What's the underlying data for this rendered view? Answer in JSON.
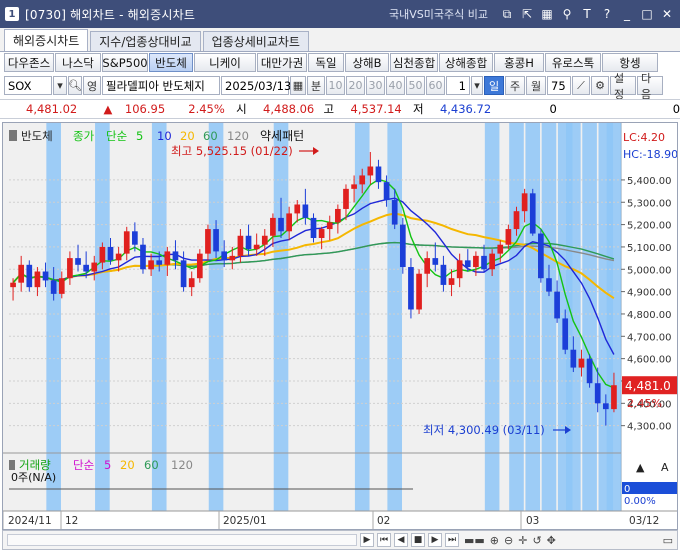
{
  "window": {
    "number": "1",
    "title": "[0730] 해외차트 - 해외증시차트",
    "compare_label": "국내VS미국주식 비교",
    "icons": [
      "link-icon",
      "popout-icon",
      "grid-icon",
      "pin-icon",
      "font-icon",
      "help-icon",
      "minimize-icon",
      "maximize-icon",
      "close-icon"
    ],
    "icon_glyphs": [
      "⧉",
      "⇱",
      "▦",
      "⚲",
      "T",
      "?",
      "_",
      "□",
      "✕"
    ]
  },
  "tabs": [
    {
      "label": "해외증시차트",
      "active": true
    },
    {
      "label": "지수/업종상대비교",
      "active": false
    },
    {
      "label": "업종상세비교차트",
      "active": false
    }
  ],
  "markets": [
    {
      "label": "다우존스",
      "w": 50
    },
    {
      "label": "나스닥",
      "w": 46
    },
    {
      "label": "S&P500",
      "w": 46
    },
    {
      "label": "반도체",
      "w": 44,
      "active": true
    },
    {
      "label": "니케이",
      "w": 62
    },
    {
      "label": "대만가권",
      "w": 50
    },
    {
      "label": "독일",
      "w": 36
    },
    {
      "label": "상해B",
      "w": 44
    },
    {
      "label": "심천종합",
      "w": 48
    },
    {
      "label": "상해종합",
      "w": 54
    },
    {
      "label": "홍콩H",
      "w": 50
    },
    {
      "label": "유로스톡",
      "w": 56
    },
    {
      "label": "항셍",
      "w": 56
    }
  ],
  "controls": {
    "symbol": "SOX",
    "type_label": "영",
    "name": "필라델피아 반도체지",
    "date": "2025/03/13",
    "period_min": "분",
    "periods": [
      "10",
      "20",
      "30",
      "40",
      "50",
      "60"
    ],
    "interval_value": "1",
    "day": "일",
    "week": "주",
    "month": "월",
    "count": "75",
    "settings": "설정",
    "next": "다음"
  },
  "quote": {
    "price": "4,481.02",
    "change_arrow": "▲",
    "change": "106.95",
    "change_pct": "2.45%",
    "open_label": "시",
    "open": "4,488.06",
    "high_label": "고",
    "high": "4,537.14",
    "low_label": "저",
    "low": "4,436.72",
    "volume": "0",
    "volume2": "0"
  },
  "chart_data": {
    "type": "candlestick",
    "legend": {
      "name": "반도체",
      "price_label": "종가",
      "ma_label": "단순",
      "ma_periods": [
        "5",
        "10",
        "20",
        "60",
        "120"
      ],
      "pattern": "약세패턴"
    },
    "ma_colors": {
      "5": "#13c313",
      "10": "#1f27d8",
      "20": "#f5b700",
      "60": "#2f9a58",
      "120": "#888888"
    },
    "annotations": {
      "high": "최고 5,525.15 (01/22)",
      "low": "최저 4,300.49 (03/11)"
    },
    "axis_right": {
      "lc": "LC:4.20",
      "hc": "HC:-18.90",
      "ticks": [
        "5,400.00",
        "5,300.00",
        "5,200.00",
        "5,100.00",
        "5,000.00",
        "4,900.00",
        "4,800.00",
        "4,700.00",
        "4,600.00",
        "4,500.00",
        "4,400.00",
        "4,300.00"
      ],
      "tick_values": [
        5400,
        5300,
        5200,
        5100,
        5000,
        4900,
        4800,
        4700,
        4600,
        4500,
        4400,
        4300
      ],
      "current_price": "4,481.0",
      "current_pct": "2.45%"
    },
    "volume_panel": {
      "label": "거래량",
      "ma_label": "단순",
      "periods": [
        "5",
        "20",
        "60",
        "120"
      ],
      "value": "0주(N/A)",
      "axis_value": "0",
      "axis_pct": "0.00%"
    },
    "x_labels": [
      "2024/11",
      "12",
      "2025/01",
      "02",
      "03"
    ],
    "x_label_end": "03/12",
    "candles": [
      [
        4920,
        4960,
        4860,
        4940
      ],
      [
        4940,
        5060,
        4900,
        5020
      ],
      [
        5020,
        5040,
        4900,
        4920
      ],
      [
        4920,
        5010,
        4880,
        4990
      ],
      [
        4990,
        5030,
        4920,
        4950
      ],
      [
        4950,
        5010,
        4860,
        4890
      ],
      [
        4890,
        4990,
        4870,
        4960
      ],
      [
        4960,
        5080,
        4930,
        5050
      ],
      [
        5050,
        5110,
        4990,
        5020
      ],
      [
        5020,
        5080,
        4960,
        4990
      ],
      [
        4990,
        5060,
        4950,
        5030
      ],
      [
        5030,
        5120,
        5000,
        5100
      ],
      [
        5100,
        5140,
        5020,
        5040
      ],
      [
        5040,
        5100,
        4990,
        5070
      ],
      [
        5070,
        5190,
        5040,
        5170
      ],
      [
        5170,
        5210,
        5080,
        5110
      ],
      [
        5110,
        5140,
        4980,
        5000
      ],
      [
        5000,
        5070,
        4970,
        5040
      ],
      [
        5040,
        5080,
        4990,
        5020
      ],
      [
        5020,
        5100,
        4970,
        5080
      ],
      [
        5080,
        5130,
        5000,
        5040
      ],
      [
        5040,
        5080,
        4900,
        4920
      ],
      [
        4920,
        4990,
        4880,
        4960
      ],
      [
        4960,
        5090,
        4940,
        5070
      ],
      [
        5070,
        5200,
        5040,
        5180
      ],
      [
        5180,
        5220,
        5050,
        5080
      ],
      [
        5080,
        5130,
        5010,
        5040
      ],
      [
        5040,
        5100,
        5000,
        5060
      ],
      [
        5060,
        5180,
        5030,
        5150
      ],
      [
        5150,
        5200,
        5060,
        5090
      ],
      [
        5090,
        5160,
        5060,
        5110
      ],
      [
        5110,
        5180,
        5060,
        5150
      ],
      [
        5150,
        5250,
        5100,
        5230
      ],
      [
        5230,
        5320,
        5140,
        5170
      ],
      [
        5170,
        5280,
        5130,
        5250
      ],
      [
        5250,
        5310,
        5210,
        5290
      ],
      [
        5290,
        5360,
        5200,
        5230
      ],
      [
        5230,
        5250,
        5120,
        5140
      ],
      [
        5140,
        5190,
        5090,
        5180
      ],
      [
        5180,
        5240,
        5130,
        5210
      ],
      [
        5210,
        5290,
        5160,
        5270
      ],
      [
        5270,
        5380,
        5220,
        5360
      ],
      [
        5360,
        5420,
        5300,
        5380
      ],
      [
        5380,
        5450,
        5340,
        5420
      ],
      [
        5420,
        5525,
        5380,
        5460
      ],
      [
        5460,
        5490,
        5360,
        5390
      ],
      [
        5390,
        5420,
        5280,
        5310
      ],
      [
        5310,
        5360,
        5180,
        5200
      ],
      [
        5200,
        5230,
        4980,
        5010
      ],
      [
        5010,
        5050,
        4780,
        4820
      ],
      [
        4820,
        5000,
        4800,
        4980
      ],
      [
        4980,
        5080,
        4920,
        5050
      ],
      [
        5050,
        5120,
        4990,
        5020
      ],
      [
        5020,
        5060,
        4900,
        4930
      ],
      [
        4930,
        5000,
        4880,
        4960
      ],
      [
        4960,
        5070,
        4920,
        5040
      ],
      [
        5040,
        5090,
        4990,
        5010
      ],
      [
        5010,
        5080,
        4970,
        5060
      ],
      [
        5060,
        5110,
        4990,
        5000
      ],
      [
        5000,
        5090,
        4970,
        5070
      ],
      [
        5070,
        5130,
        5030,
        5110
      ],
      [
        5110,
        5200,
        5090,
        5180
      ],
      [
        5180,
        5280,
        5150,
        5260
      ],
      [
        5260,
        5360,
        5210,
        5340
      ],
      [
        5340,
        5360,
        5150,
        5160
      ],
      [
        5160,
        5180,
        4940,
        4960
      ],
      [
        4960,
        5020,
        4880,
        4900
      ],
      [
        4900,
        4950,
        4760,
        4780
      ],
      [
        4780,
        4820,
        4620,
        4640
      ],
      [
        4640,
        4700,
        4540,
        4560
      ],
      [
        4560,
        4640,
        4520,
        4600
      ],
      [
        4600,
        4620,
        4470,
        4490
      ],
      [
        4490,
        4560,
        4360,
        4400
      ],
      [
        4400,
        4440,
        4300,
        4374
      ],
      [
        4374,
        4537,
        4360,
        4481
      ]
    ],
    "shaded_columns": [
      5,
      11,
      18,
      25,
      33,
      43,
      47,
      59,
      62,
      64,
      66,
      68,
      69,
      71,
      73,
      74
    ]
  }
}
